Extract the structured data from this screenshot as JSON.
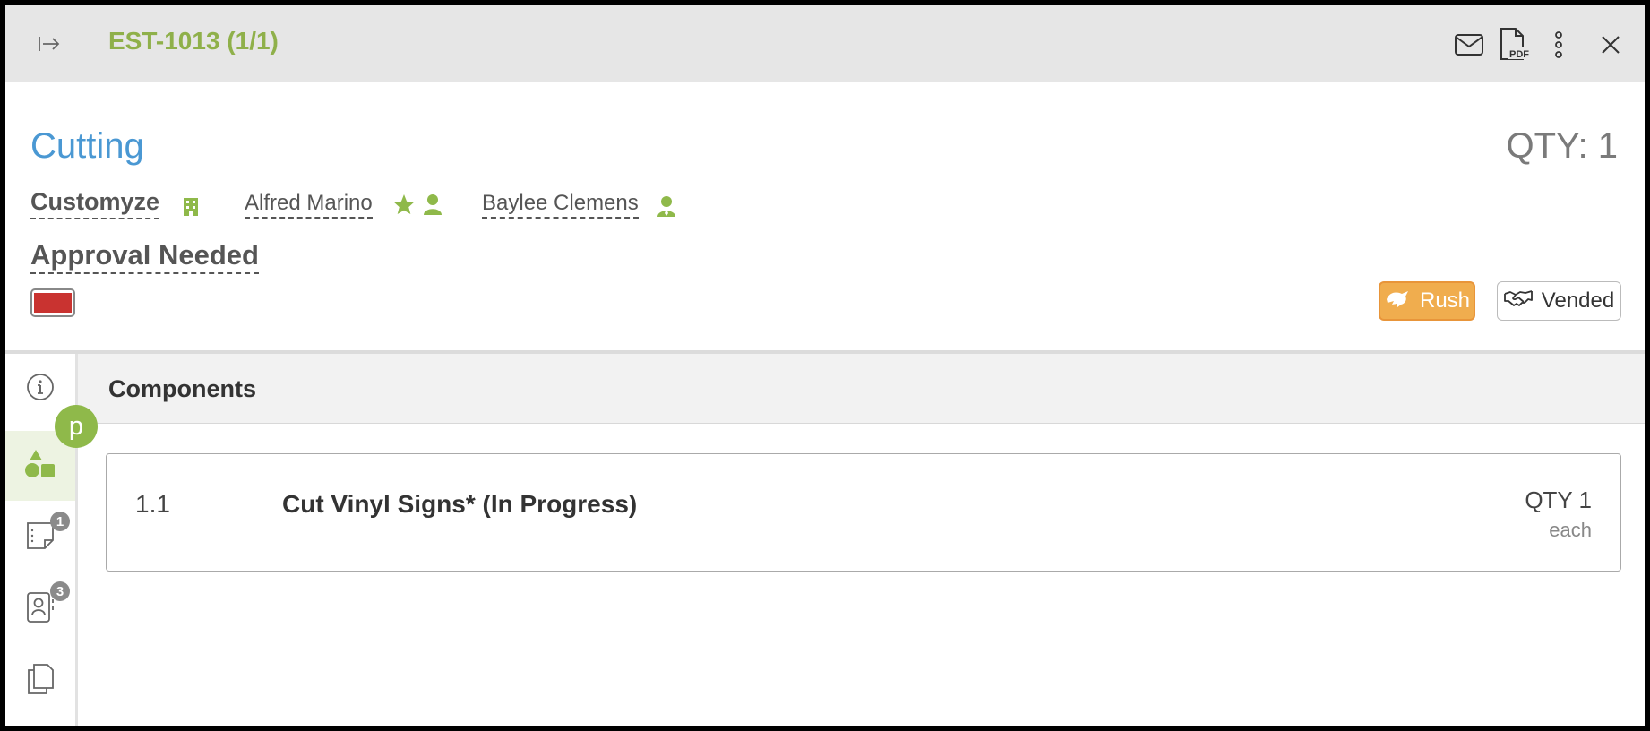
{
  "header": {
    "estimate_title": "EST-1013 (1/1)",
    "icons": [
      "collapse-icon",
      "email-icon",
      "pdf-icon",
      "more-icon",
      "close-icon"
    ],
    "pdf_label": "PDF"
  },
  "order": {
    "stage": "Cutting",
    "qty_label": "QTY: 1",
    "customer": "Customyze",
    "contact_primary": "Alfred Marino",
    "contact_secondary": "Baylee Clemens",
    "status": "Approval Needed",
    "color_swatch": "#c93330",
    "rush_label": "Rush",
    "vended_label": "Vended"
  },
  "sidebar": {
    "bubble_letter": "p",
    "items": [
      {
        "name": "info",
        "badge": ""
      },
      {
        "name": "components",
        "badge": ""
      },
      {
        "name": "notes",
        "badge": "1"
      },
      {
        "name": "contacts",
        "badge": "3"
      },
      {
        "name": "documents",
        "badge": ""
      }
    ]
  },
  "panel": {
    "title": "Components",
    "components": [
      {
        "number": "1.1",
        "name": "Cut Vinyl Signs* (In Progress)",
        "qty": "QTY 1",
        "unit": "each"
      }
    ]
  },
  "colors": {
    "accent_green": "#8fb04a",
    "title_blue": "#4a98d3",
    "rush_orange": "#f0ad4e"
  }
}
